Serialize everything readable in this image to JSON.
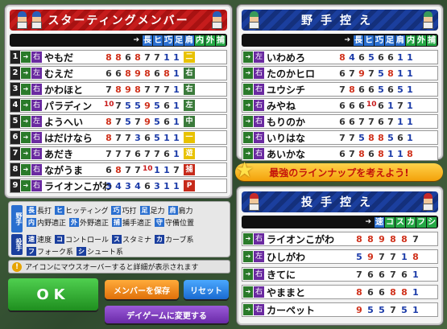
{
  "starting": {
    "title": "スターティングメンバー",
    "col_labels": [
      "長",
      "ヒ",
      "巧",
      "足",
      "肩",
      "内",
      "外",
      "捕"
    ],
    "players": [
      {
        "order": "1",
        "pos": "",
        "hand": "右",
        "name": "やもだ",
        "stats": [
          "8",
          "8",
          "6",
          "8",
          "7",
          "7",
          "1",
          "1"
        ],
        "badge": "二",
        "badge_color": "#e8c200"
      },
      {
        "order": "2",
        "pos": "",
        "hand": "左",
        "name": "むえだ",
        "stats": [
          "6",
          "6",
          "8",
          "9",
          "8",
          "6",
          "8",
          "1"
        ],
        "badge": "右",
        "badge_color": "#3a7a3a"
      },
      {
        "order": "3",
        "pos": "",
        "hand": "右",
        "name": "かわほと",
        "stats": [
          "7",
          "8",
          "9",
          "8",
          "7",
          "7",
          "7",
          "1"
        ],
        "badge": "右",
        "badge_color": "#3a7a3a"
      },
      {
        "order": "4",
        "pos": "",
        "hand": "右",
        "name": "パラディン",
        "stats": [
          "10",
          "7",
          "5",
          "5",
          "9",
          "5",
          "6",
          "1"
        ],
        "badge": "左",
        "badge_color": "#3a7a3a"
      },
      {
        "order": "5",
        "pos": "",
        "hand": "左",
        "name": "ようへい",
        "stats": [
          "8",
          "7",
          "5",
          "7",
          "9",
          "5",
          "6",
          "1"
        ],
        "badge": "中",
        "badge_color": "#3a7a3a"
      },
      {
        "order": "6",
        "pos": "",
        "hand": "右",
        "name": "はだけなら",
        "stats": [
          "8",
          "7",
          "7",
          "3",
          "6",
          "5",
          "1",
          "1"
        ],
        "badge": "一",
        "badge_color": "#e8c200"
      },
      {
        "order": "7",
        "pos": "",
        "hand": "右",
        "name": "あだき",
        "stats": [
          "7",
          "7",
          "7",
          "6",
          "7",
          "7",
          "6",
          "1"
        ],
        "badge": "遊",
        "badge_color": "#e8c200"
      },
      {
        "order": "8",
        "pos": "",
        "hand": "右",
        "name": "ながうま",
        "stats": [
          "6",
          "8",
          "7",
          "7",
          "10",
          "1",
          "1",
          "7"
        ],
        "badge": "捕",
        "badge_color": "#c62a1a"
      },
      {
        "order": "9",
        "pos": "",
        "hand": "右",
        "name": "ライオンこがわ",
        "stats": [
          "3",
          "4",
          "3",
          "4",
          "6",
          "3",
          "1",
          "1"
        ],
        "badge": "P",
        "badge_color": "#c62a1a"
      }
    ]
  },
  "bench": {
    "title": "野手控え",
    "col_labels": [
      "長",
      "ヒ",
      "巧",
      "足",
      "肩",
      "内",
      "外",
      "捕"
    ],
    "players": [
      {
        "hand": "左",
        "name": "いわめろ",
        "stats": [
          "8",
          "4",
          "6",
          "5",
          "6",
          "6",
          "1",
          "1"
        ]
      },
      {
        "hand": "右",
        "name": "たのかヒロ",
        "stats": [
          "6",
          "7",
          "9",
          "7",
          "5",
          "8",
          "1",
          "1"
        ]
      },
      {
        "hand": "右",
        "name": "ユウシチ",
        "stats": [
          "7",
          "8",
          "6",
          "6",
          "5",
          "6",
          "5",
          "1"
        ]
      },
      {
        "hand": "右",
        "name": "みやね",
        "stats": [
          "6",
          "6",
          "6",
          "10",
          "6",
          "1",
          "7",
          "1"
        ]
      },
      {
        "hand": "右",
        "name": "もりのか",
        "stats": [
          "6",
          "6",
          "7",
          "7",
          "6",
          "7",
          "1",
          "1"
        ]
      },
      {
        "hand": "右",
        "name": "いりはな",
        "stats": [
          "7",
          "7",
          "5",
          "8",
          "8",
          "5",
          "6",
          "1"
        ]
      },
      {
        "hand": "右",
        "name": "あいかな",
        "stats": [
          "6",
          "7",
          "8",
          "6",
          "8",
          "1",
          "1",
          "8"
        ]
      }
    ]
  },
  "lineup_banner": "最強のラインナップを考えよう!",
  "pitchers": {
    "title": "投手控え",
    "col_labels": [
      "速",
      "コ",
      "ス",
      "カ",
      "フ",
      "シ"
    ],
    "players": [
      {
        "hand": "右",
        "name": "ライオンこがわ",
        "stats": [
          "8",
          "8",
          "9",
          "8",
          "8",
          "7"
        ]
      },
      {
        "hand": "左",
        "name": "ひしがわ",
        "stats": [
          "5",
          "9",
          "7",
          "7",
          "1",
          "8"
        ]
      },
      {
        "hand": "右",
        "name": "きてに",
        "stats": [
          "7",
          "6",
          "6",
          "7",
          "6",
          "1"
        ]
      },
      {
        "hand": "右",
        "name": "やままと",
        "stats": [
          "8",
          "6",
          "6",
          "8",
          "8",
          "1"
        ]
      },
      {
        "hand": "右",
        "name": "カーペット",
        "stats": [
          "9",
          "5",
          "5",
          "7",
          "5",
          "1"
        ]
      }
    ]
  },
  "legend": {
    "fielder_label": "野手",
    "fielder_items": [
      {
        "k": "長",
        "t": "長打"
      },
      {
        "k": "ヒ",
        "t": "ヒッティング"
      },
      {
        "k": "巧",
        "t": "巧打"
      },
      {
        "k": "足",
        "t": "足力"
      },
      {
        "k": "肩",
        "t": "肩力"
      },
      {
        "k": "内",
        "t": "内野適正"
      },
      {
        "k": "外",
        "t": "外野適正"
      },
      {
        "k": "捕",
        "t": "捕手適正"
      },
      {
        "k": "守",
        "t": "守備位置"
      }
    ],
    "pitcher_label": "投手",
    "pitcher_items": [
      {
        "k": "速",
        "t": "速度"
      },
      {
        "k": "コ",
        "t": "コントロール"
      },
      {
        "k": "ス",
        "t": "スタミナ"
      },
      {
        "k": "カ",
        "t": "カーブ系"
      },
      {
        "k": "フ",
        "t": "フォーク系"
      },
      {
        "k": "シ",
        "t": "シュート系"
      }
    ]
  },
  "notice": "アイコンにマウスオーバーすると詳細が表示されます",
  "buttons": {
    "ok": "OK",
    "save": "メンバーを保存",
    "reset": "リセット",
    "day_game": "デイゲームに変更する"
  },
  "colors": {
    "red": "#c61c1c",
    "blue": "#1b3f9e",
    "green": "#2ba92b",
    "orange": "#f08a12",
    "sky": "#2a8ae0",
    "purple": "#7a3ab8"
  }
}
